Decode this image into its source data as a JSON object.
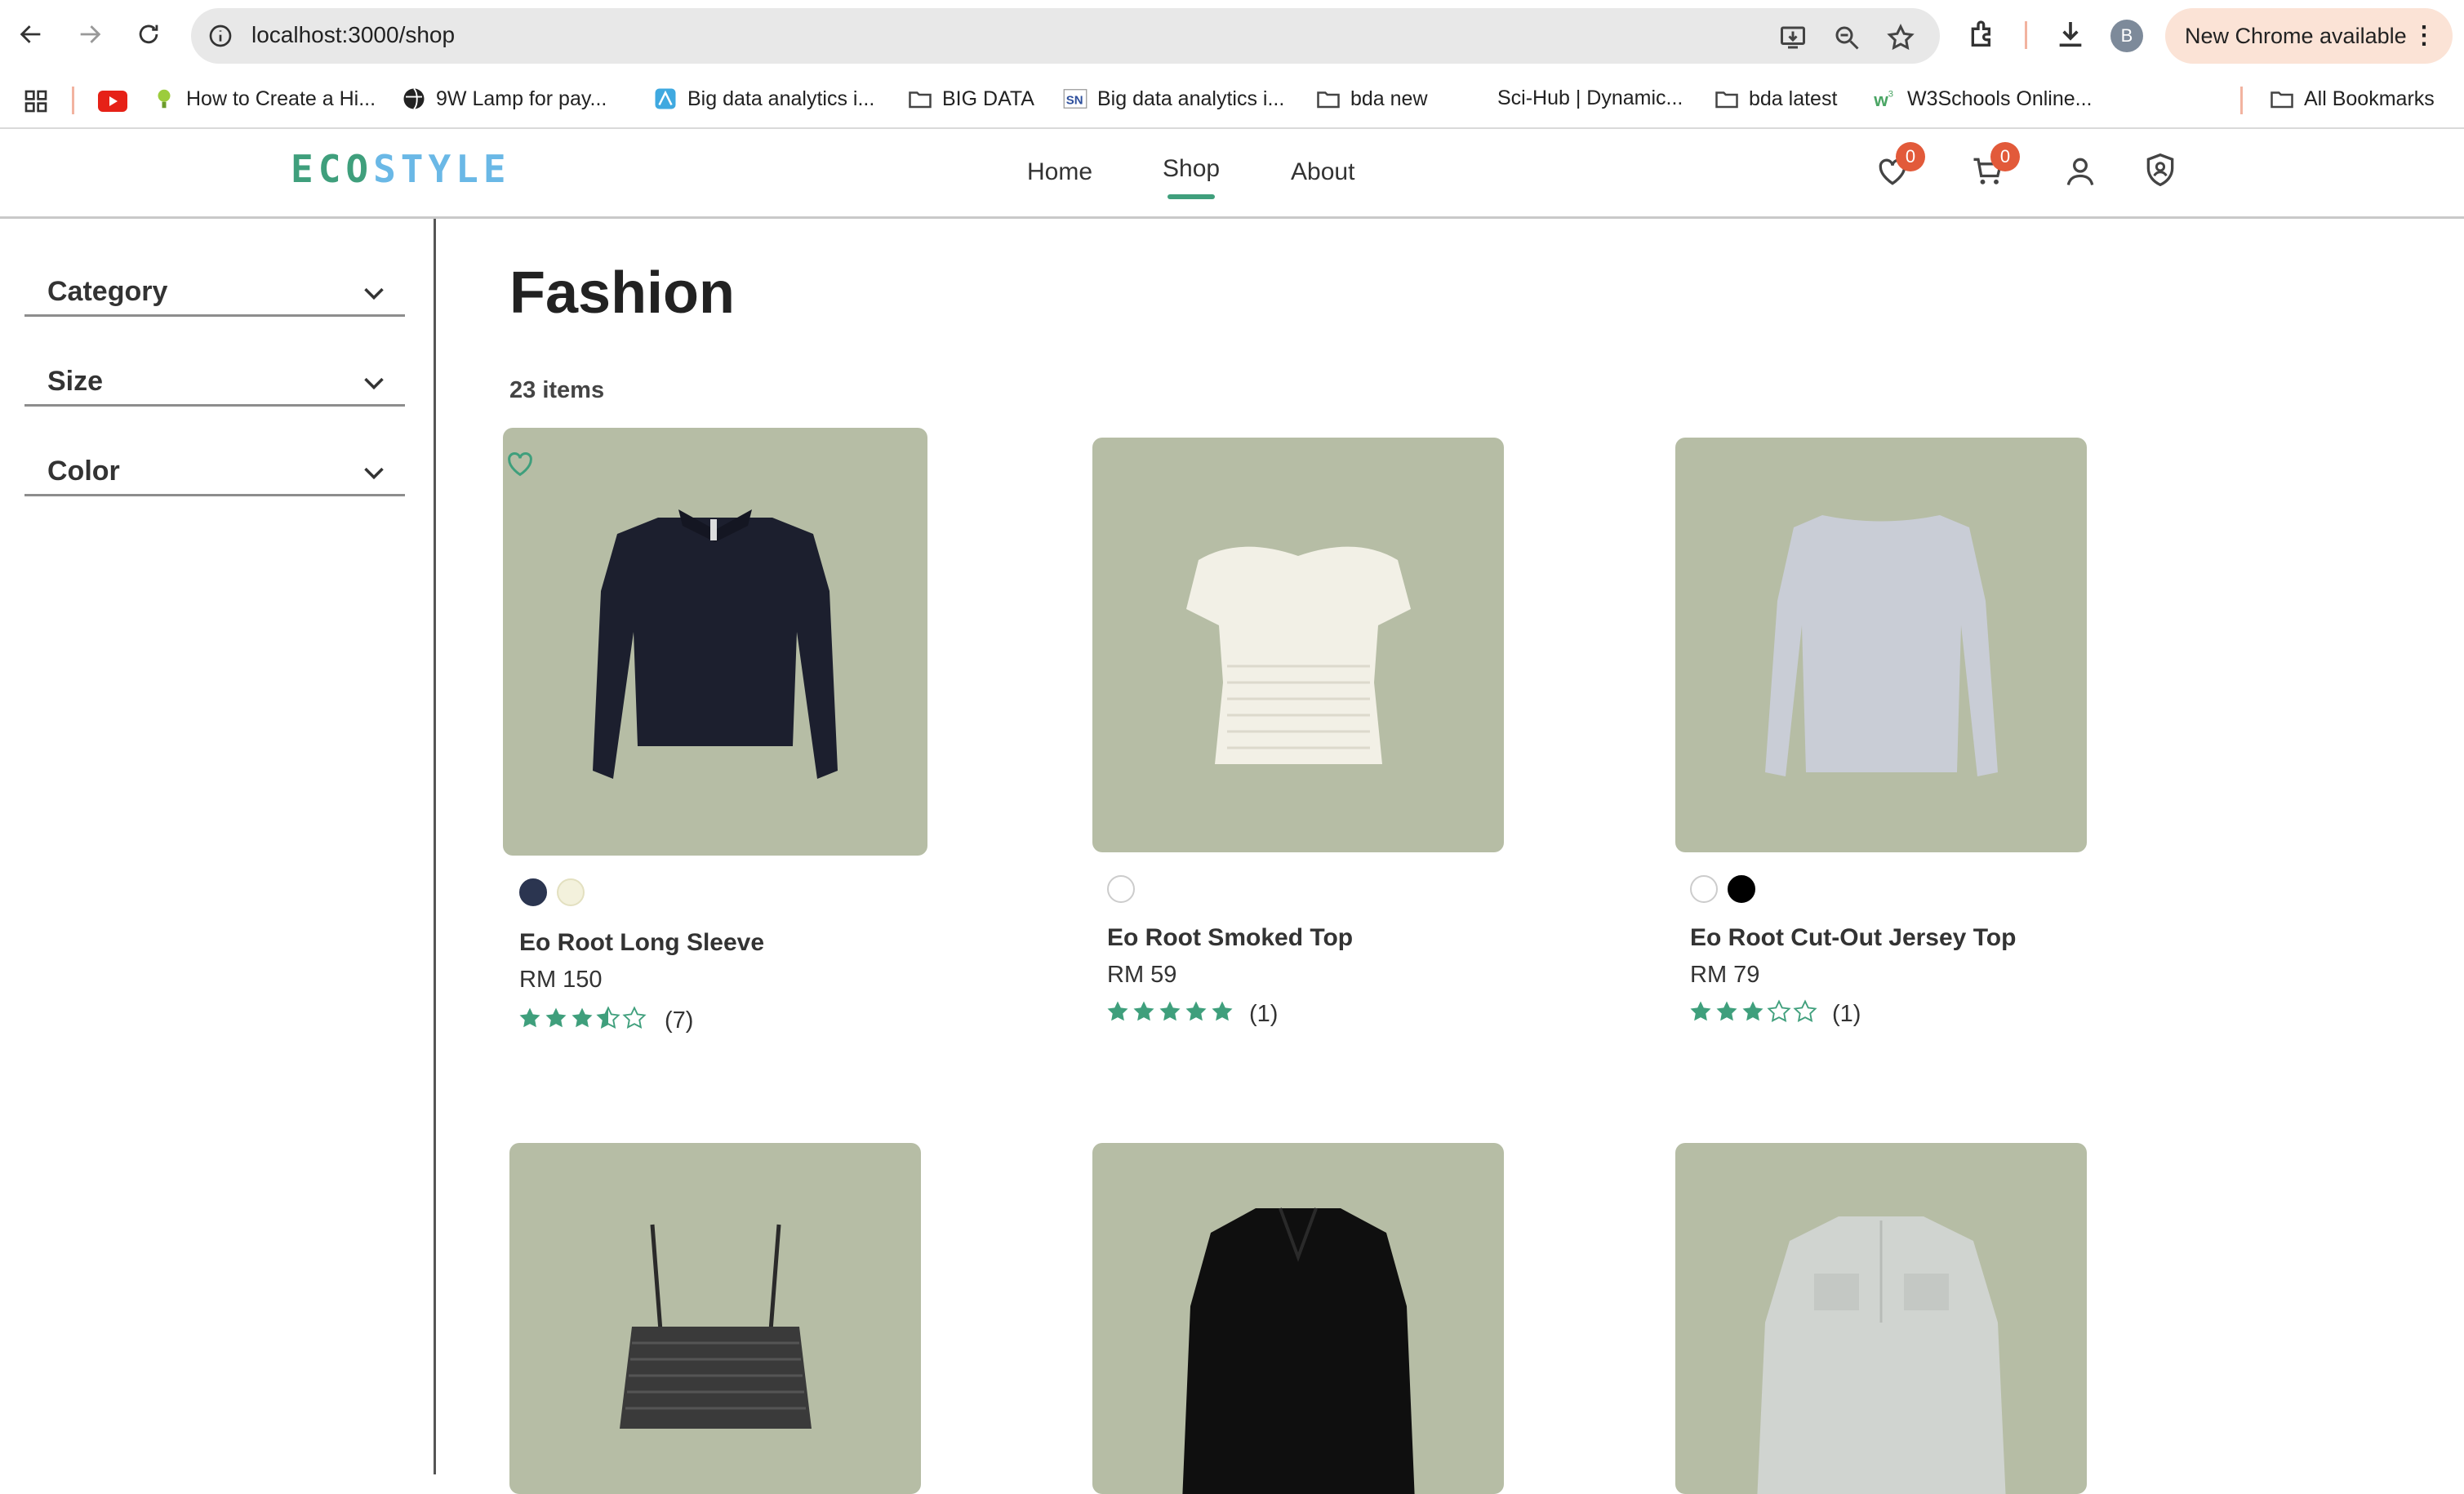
{
  "browser": {
    "url": "localhost:3000/shop",
    "new_chrome_label": "New Chrome available",
    "profile_initial": "B",
    "bookmarks": [
      {
        "label": "How to Create a Hi..."
      },
      {
        "label": "9W Lamp for pay..."
      },
      {
        "label": "Big data analytics i..."
      },
      {
        "label": "BIG DATA"
      },
      {
        "label": "Big data analytics i..."
      },
      {
        "label": "bda new"
      },
      {
        "label": "Sci-Hub | Dynamic..."
      },
      {
        "label": "bda latest"
      },
      {
        "label": "W3Schools Online..."
      },
      {
        "label": "All Bookmarks"
      }
    ]
  },
  "header": {
    "logo_part1": "ECO",
    "logo_part2": "STYLE",
    "nav": [
      {
        "label": "Home"
      },
      {
        "label": "Shop",
        "active": true
      },
      {
        "label": "About"
      }
    ],
    "wishlist_count": "0",
    "cart_count": "0",
    "accent": "#3f9f7c"
  },
  "sidebar": {
    "filters": [
      {
        "label": "Category"
      },
      {
        "label": "Size"
      },
      {
        "label": "Color"
      }
    ]
  },
  "main": {
    "title": "Fashion",
    "item_count": "23 items",
    "products": [
      {
        "name": "Eo Root Long Sleeve",
        "price": "RM 150",
        "rating": 3.5,
        "reviews": "(7)",
        "swatches": [
          "#2b3550",
          "#f3f1dc"
        ]
      },
      {
        "name": "Eo Root Smoked Top",
        "price": "RM 59",
        "rating": 5,
        "reviews": "(1)",
        "swatches": [
          "#ffffff"
        ]
      },
      {
        "name": "Eo Root Cut-Out Jersey Top",
        "price": "RM 79",
        "rating": 3,
        "reviews": "(1)",
        "swatches": [
          "#ffffff",
          "#000000"
        ]
      },
      {
        "name": "",
        "price": "",
        "rating": 0,
        "reviews": "",
        "swatches": []
      },
      {
        "name": "",
        "price": "",
        "rating": 0,
        "reviews": "",
        "swatches": []
      },
      {
        "name": "",
        "price": "",
        "rating": 0,
        "reviews": "",
        "swatches": []
      }
    ]
  }
}
